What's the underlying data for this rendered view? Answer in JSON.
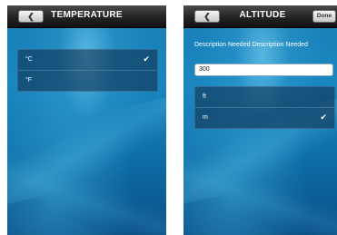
{
  "left_screen": {
    "title": "TEMPERATURE",
    "back_label": "❮",
    "options": [
      {
        "label": "°C",
        "selected": true
      },
      {
        "label": "°F",
        "selected": false
      }
    ]
  },
  "right_screen": {
    "title": "ALTITUDE",
    "back_label": "❮",
    "done_label": "Done",
    "description": "Description Needed Description Needed",
    "input_value": "300",
    "options": [
      {
        "label": "ft",
        "selected": false
      },
      {
        "label": "m",
        "selected": true
      }
    ]
  },
  "icons": {
    "checkmark": "check-icon",
    "back": "back-arrow-icon"
  },
  "colors": {
    "background_top": "#1a86c0",
    "background_bottom": "#0a4f86",
    "navbar": "#1a1a1a"
  },
  "check_glyph": "✔"
}
